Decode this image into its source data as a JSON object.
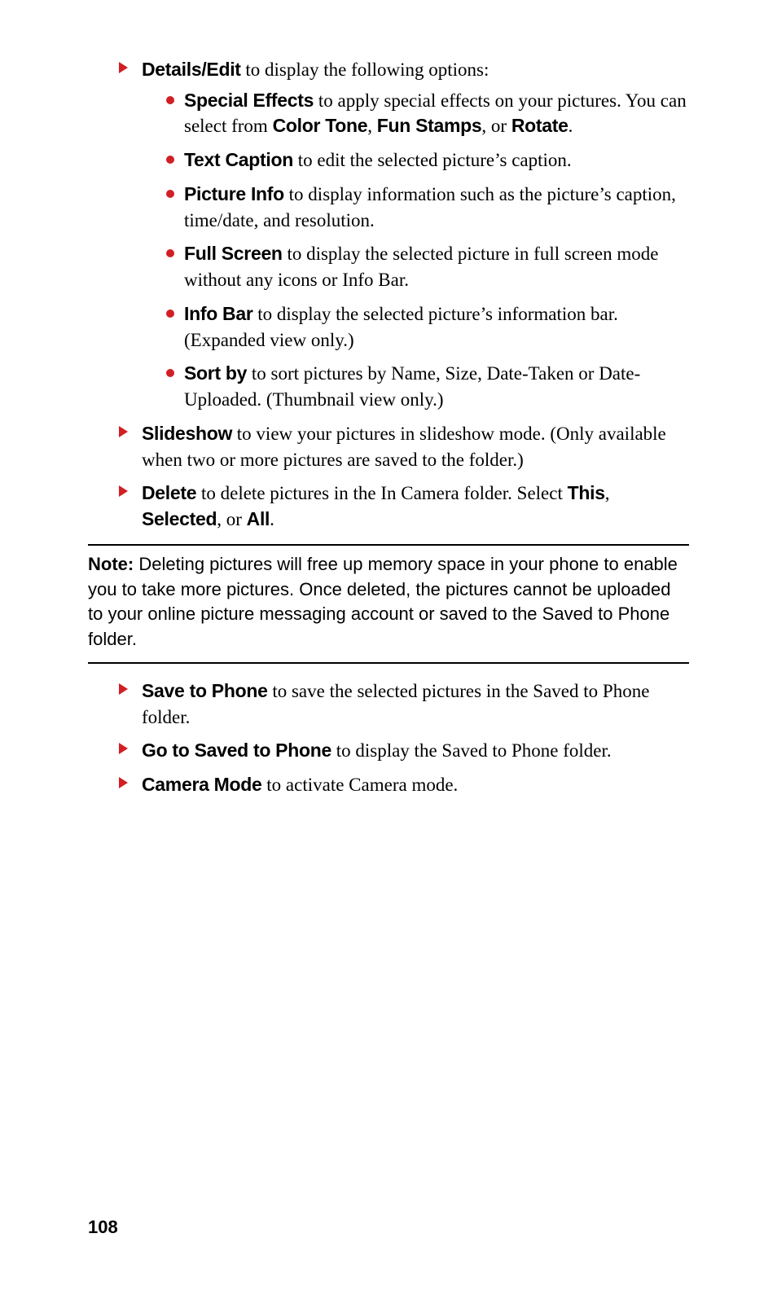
{
  "list1": [
    {
      "bold": "Details/Edit",
      "text": " to display the following options:",
      "sub": [
        {
          "bold": "Special Effects",
          "text": " to apply special effects on your pictures. You can select from ",
          "tail_bold": [
            "Color Tone",
            "Fun Stamps",
            "Rotate"
          ],
          "tail_joins": [
            ", ",
            ", or ",
            "."
          ]
        },
        {
          "bold": "Text Caption",
          "text": " to edit the selected picture’s caption."
        },
        {
          "bold": "Picture Info",
          "text": " to display information such as the picture’s caption, time/date, and resolution."
        },
        {
          "bold": "Full Screen",
          "text": " to display the selected picture in full screen mode without any icons or Info Bar."
        },
        {
          "bold": "Info Bar",
          "text": " to display the selected picture’s information bar. (Expanded view only.)"
        },
        {
          "bold": "Sort by",
          "text": " to sort pictures by Name, Size, Date-Taken or Date-Uploaded. (Thumbnail view only.)"
        }
      ]
    },
    {
      "bold": "Slideshow",
      "text": " to view your pictures in slideshow mode. (Only available when two or more pictures are saved to the folder.)"
    },
    {
      "bold": "Delete",
      "text": " to delete pictures in the In Camera folder. Select ",
      "tail_bold": [
        "This",
        "Selected",
        "All"
      ],
      "tail_joins": [
        ", ",
        ", or ",
        "."
      ]
    }
  ],
  "note": {
    "label": "Note:",
    "text": " Deleting pictures will free up memory space in your phone to enable you to take more pictures. Once deleted, the pictures cannot be uploaded to your online picture messaging account or saved to the Saved to Phone folder."
  },
  "list2": [
    {
      "bold": "Save to Phone",
      "text": " to save the selected pictures in the Saved to Phone folder."
    },
    {
      "bold": "Go to Saved to Phone",
      "text": " to display the Saved to Phone folder."
    },
    {
      "bold": "Camera Mode",
      "text": " to activate Camera mode."
    }
  ],
  "page_number": "108"
}
